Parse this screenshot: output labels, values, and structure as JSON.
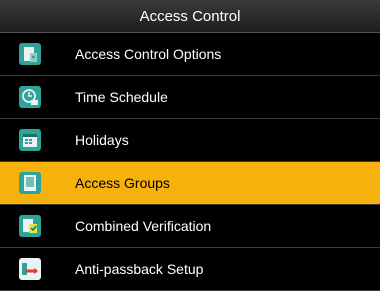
{
  "window": {
    "title": "Access Control"
  },
  "menu": {
    "items": [
      {
        "label": "Access Control Options",
        "icon": "access-options-icon"
      },
      {
        "label": "Time Schedule",
        "icon": "time-schedule-icon"
      },
      {
        "label": "Holidays",
        "icon": "holidays-icon"
      },
      {
        "label": "Access Groups",
        "icon": "access-groups-icon",
        "selected": true
      },
      {
        "label": "Combined Verification",
        "icon": "combined-verification-icon"
      },
      {
        "label": "Anti-passback Setup",
        "icon": "anti-passback-icon"
      }
    ]
  },
  "colors": {
    "selected_background": "#f7b10d",
    "title_background": "#2b2b2b",
    "icon_teal": "#2fa39a"
  }
}
